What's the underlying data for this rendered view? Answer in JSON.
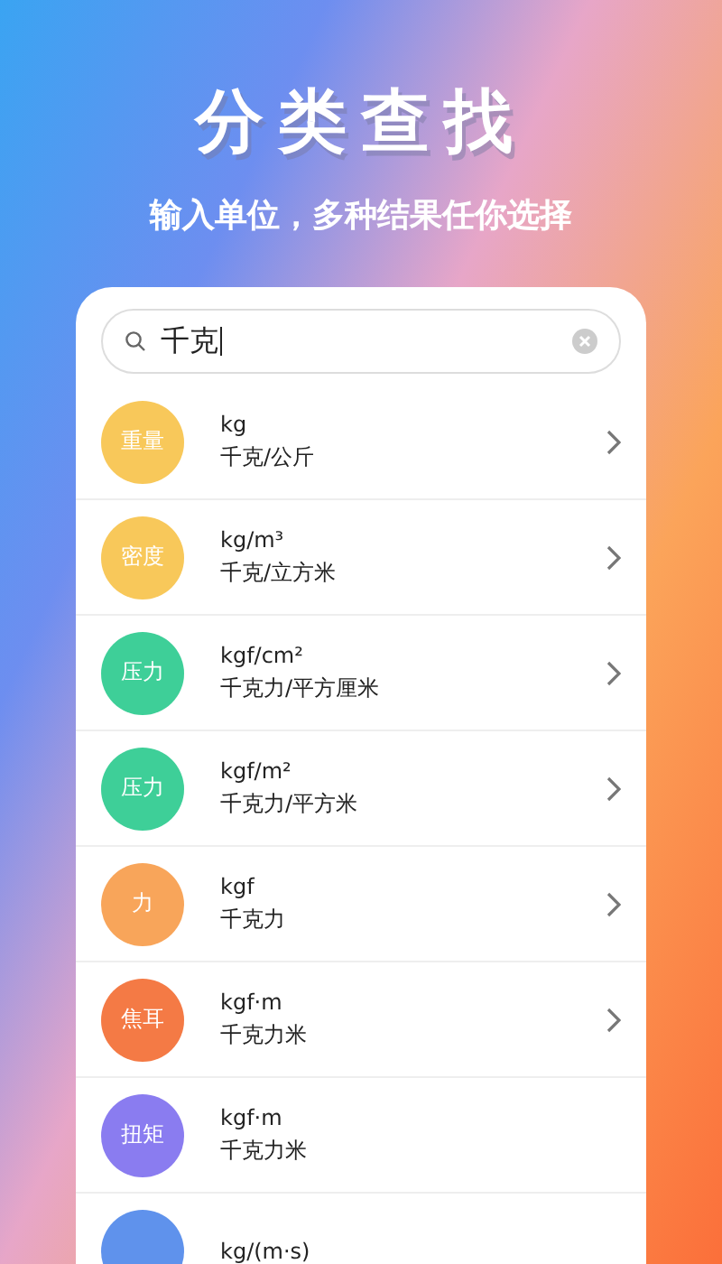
{
  "heading": "分类查找",
  "subheading": "输入单位，多种结果任你选择",
  "search": {
    "value": "千克"
  },
  "results": [
    {
      "badge": "重量",
      "color": "#f8c85a",
      "symbol": "kg",
      "name": "千克/公斤",
      "chevron": true
    },
    {
      "badge": "密度",
      "color": "#f8c85a",
      "symbol": "kg/m³",
      "name": "千克/立方米",
      "chevron": true
    },
    {
      "badge": "压力",
      "color": "#3ecf98",
      "symbol": "kgf/cm²",
      "name": "千克力/平方厘米",
      "chevron": true
    },
    {
      "badge": "压力",
      "color": "#3ecf98",
      "symbol": "kgf/m²",
      "name": "千克力/平方米",
      "chevron": true
    },
    {
      "badge": "力",
      "color": "#f8a55a",
      "symbol": "kgf",
      "name": "千克力",
      "chevron": true
    },
    {
      "badge": "焦耳",
      "color": "#f47a45",
      "symbol": "kgf·m",
      "name": "千克力米",
      "chevron": true
    },
    {
      "badge": "扭矩",
      "color": "#8a7cf0",
      "symbol": "kgf·m",
      "name": "千克力米",
      "chevron": false
    },
    {
      "color": "#5f92ec",
      "symbol": "kg/(m·s)",
      "chevron": false
    }
  ]
}
